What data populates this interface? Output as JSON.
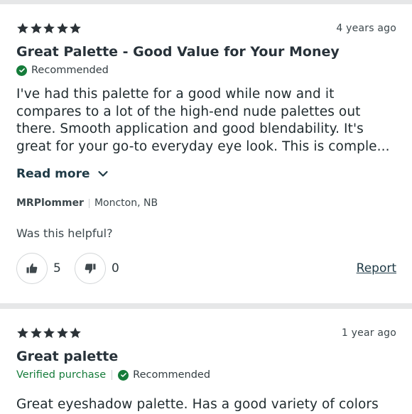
{
  "reviews": [
    {
      "rating": 5,
      "date": "4 years ago",
      "title": "Great Palette - Good Value for Your Money",
      "recommended_label": "Recommended",
      "body": "I've had this palette for a good while now and it compares to a lot of the high-end nude palettes out there. Smooth application and good blendability. It's great for your go-to everyday eye look. This is comple...",
      "read_more_label": "Read more",
      "author": "MRPlommer",
      "location": "Moncton, NB",
      "helpful_question": "Was this helpful?",
      "helpful_yes_count": "5",
      "helpful_no_count": "0",
      "report_label": "Report"
    },
    {
      "rating": 5,
      "date": "1 year ago",
      "title": "Great palette",
      "verified_label": "Verified purchase",
      "recommended_label": "Recommended",
      "body": "Great eyeshadow palette. Has a good variety of colors"
    }
  ],
  "colors": {
    "star": "#2b3237",
    "verified_green": "#157c3a",
    "divider": "#e6e7e8",
    "link": "#1f3a46"
  },
  "icons": [
    "star-icon",
    "check-circle-icon",
    "chevron-down-icon",
    "thumbs-up-icon",
    "thumbs-down-icon"
  ]
}
